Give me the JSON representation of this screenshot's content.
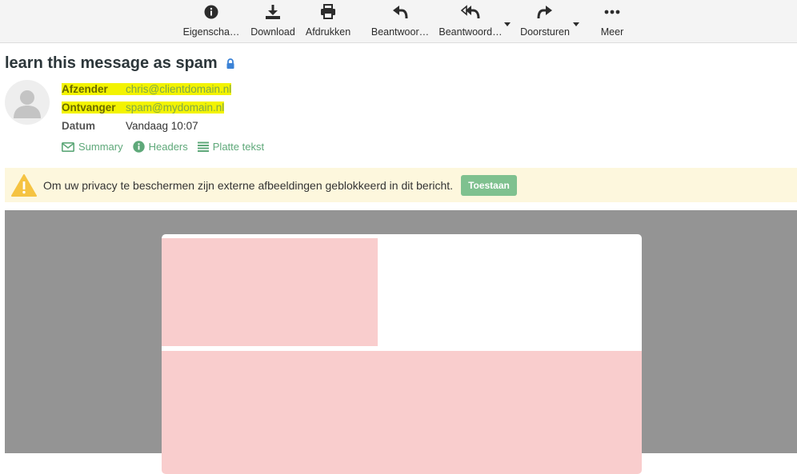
{
  "toolbar": {
    "properties": "Eigenscha…",
    "download": "Download",
    "print": "Afdrukken",
    "reply": "Beantwoor…",
    "reply_all": "Beantwoord…",
    "forward": "Doorsturen",
    "more": "Meer"
  },
  "message": {
    "subject": "learn this message as spam",
    "from_label": "Afzender",
    "from_value": "chris@clientdomain.nl",
    "to_label": "Ontvanger",
    "to_value": "spam@mydomain.nl",
    "date_label": "Datum",
    "date_value": "Vandaag 10:07",
    "links": {
      "summary": "Summary",
      "headers": "Headers",
      "plain": "Platte tekst"
    }
  },
  "privacy": {
    "text": "Om uw privacy te beschermen zijn externe afbeeldingen geblokkeerd in dit bericht.",
    "allow": "Toestaan"
  },
  "colors": {
    "highlight": "#f3f300",
    "accent_green": "#5ea879",
    "button_green": "#7fc18f",
    "banner_bg": "#fdf7dd",
    "body_bg": "#949494",
    "blocked_image": "#f9cdcd"
  },
  "icons": {
    "properties": "info-circle-icon",
    "download": "download-icon",
    "print": "printer-icon",
    "reply": "reply-icon",
    "reply_all": "reply-all-icon",
    "forward": "forward-icon",
    "more": "ellipsis-icon",
    "lock": "lock-icon",
    "warning": "warning-triangle-icon"
  }
}
